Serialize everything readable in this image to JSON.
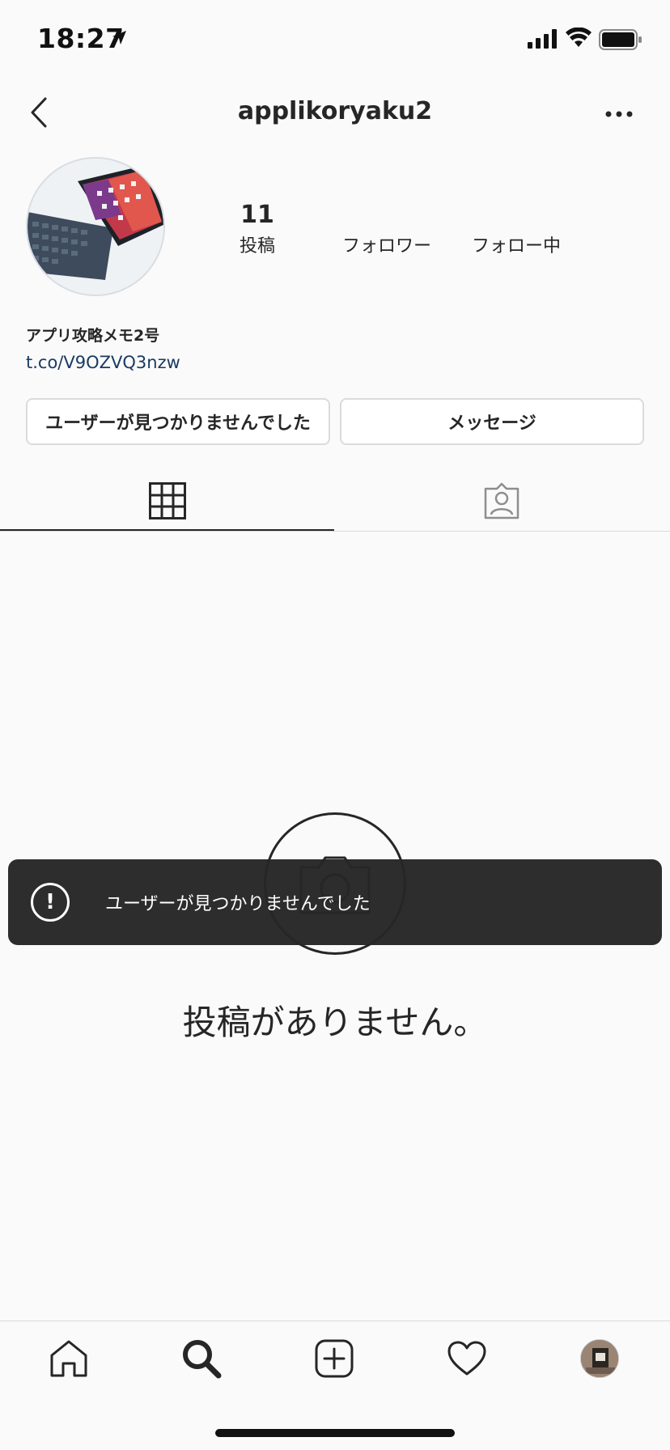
{
  "status_bar": {
    "time": "18:27"
  },
  "header": {
    "username": "applikoryaku2"
  },
  "profile": {
    "stats": [
      {
        "count": "11",
        "label": "投稿"
      },
      {
        "count": "",
        "label": "フォロワー"
      },
      {
        "count": "",
        "label": "フォロー中"
      }
    ],
    "bio_name": "アプリ攻略メモ2号",
    "bio_link": "t.co/V9OZVQ3nzw"
  },
  "actions": {
    "user_button": "ユーザーが見つかりませんでした",
    "message_button": "メッセージ"
  },
  "tabs": {
    "active": "grid"
  },
  "empty_state": {
    "text": "投稿がありません。"
  },
  "toast": {
    "text": "ユーザーが見つかりませんでした",
    "icon": "!"
  },
  "bottom_nav": {
    "items": [
      "home-icon",
      "search-icon",
      "add-icon",
      "heart-icon",
      "profile-avatar"
    ]
  }
}
